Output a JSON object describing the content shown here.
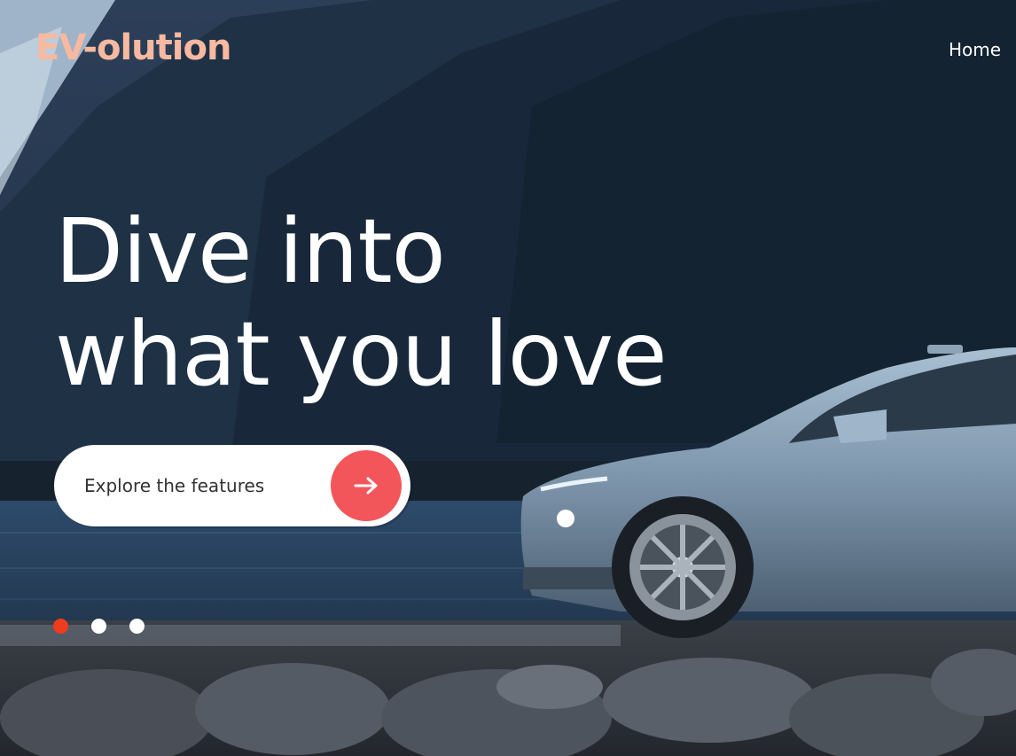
{
  "brand": {
    "name": "EV-olution",
    "color": "#f7b9a0"
  },
  "nav": {
    "items": [
      {
        "label": "Home"
      }
    ]
  },
  "hero": {
    "headline_line1": "Dive into",
    "headline_line2": "what you love",
    "cta_label": "Explore the features",
    "cta_icon": "arrow-right-icon",
    "accent_color": "#f2565a",
    "background_image": "car-on-lakeshore-mountains"
  },
  "carousel": {
    "slide_count": 3,
    "active_index": 0,
    "active_color": "#ef3c1f"
  }
}
